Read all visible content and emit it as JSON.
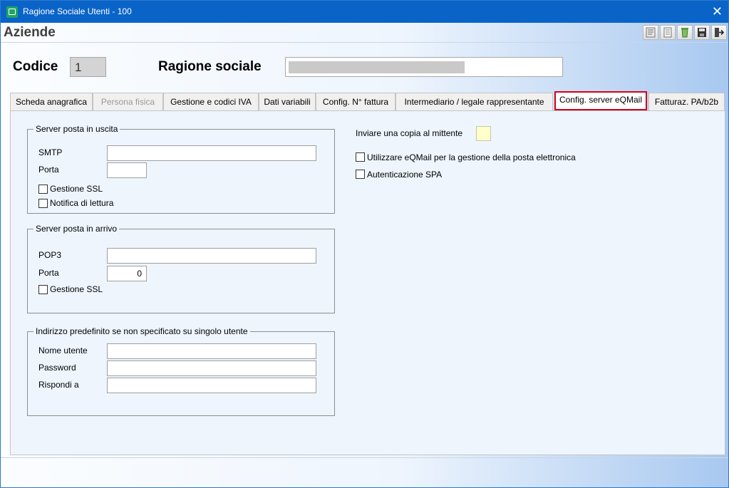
{
  "window": {
    "title": "Ragione Sociale Utenti - 100",
    "close_glyph": "✕"
  },
  "header": {
    "title": "Aziende"
  },
  "toolbar": {
    "icons": [
      "print-icon",
      "preview-icon",
      "recycle-icon",
      "save-icon",
      "exit-icon"
    ]
  },
  "fields": {
    "codice_label": "Codice",
    "codice_value": "1",
    "ragione_label": "Ragione sociale",
    "ragione_value": ""
  },
  "tabs": [
    {
      "label": "Scheda anagrafica",
      "state": "normal"
    },
    {
      "label": "Persona fisica",
      "state": "disabled"
    },
    {
      "label": "Gestione e codici IVA",
      "state": "normal"
    },
    {
      "label": "Dati variabili",
      "state": "normal"
    },
    {
      "label": "Config. N° fattura",
      "state": "normal"
    },
    {
      "label": "Intermediario / legale rappresentante",
      "state": "normal"
    },
    {
      "label": "Config. server eQMail",
      "state": "active"
    },
    {
      "label": "Fatturaz. PA/b2b",
      "state": "normal"
    }
  ],
  "outgoing": {
    "legend": "Server posta in uscita",
    "smtp_label": "SMTP",
    "smtp_value": "",
    "porta_label": "Porta",
    "porta_value": "",
    "ssl_label": "Gestione SSL",
    "ssl_checked": false,
    "read_receipt_label": "Notifica di lettura",
    "read_receipt_checked": false
  },
  "incoming": {
    "legend": "Server posta in arrivo",
    "pop3_label": "POP3",
    "pop3_value": "",
    "porta_label": "Porta",
    "porta_value": "0",
    "ssl_label": "Gestione SSL",
    "ssl_checked": false
  },
  "default_address": {
    "legend": "Indirizzo predefinito se non specificato su singolo utente",
    "username_label": "Nome utente",
    "username_value": "",
    "password_label": "Password",
    "password_value": "",
    "reply_label": "Rispondi a",
    "reply_value": ""
  },
  "options": {
    "send_copy_label": "Inviare una copia al mittente",
    "use_eqmail_label": "Utilizzare eQMail per la gestione della posta elettronica",
    "use_eqmail_checked": false,
    "spa_label": "Autenticazione SPA",
    "spa_checked": false
  },
  "colors": {
    "titlebar": "#0a64c8",
    "active_tab_border": "#d0021b",
    "panel": "#eef5fd"
  }
}
